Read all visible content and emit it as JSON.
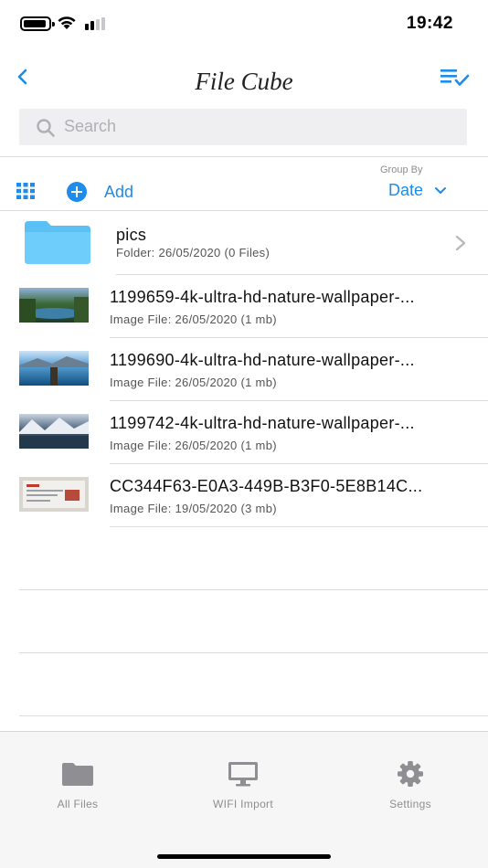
{
  "status_bar": {
    "time": "19:42"
  },
  "nav": {
    "title": "File Cube"
  },
  "search": {
    "placeholder": "Search"
  },
  "toolbar": {
    "add_label": "Add",
    "group_by_label": "Group By",
    "group_by_value": "Date"
  },
  "files": [
    {
      "name": "pics",
      "info": "Folder: 26/05/2020 (0 Files)",
      "type": "folder"
    },
    {
      "name": "1199659-4k-ultra-hd-nature-wallpaper-...",
      "info": "Image File: 26/05/2020 (1 mb)",
      "type": "image"
    },
    {
      "name": "1199690-4k-ultra-hd-nature-wallpaper-...",
      "info": "Image File: 26/05/2020 (1 mb)",
      "type": "image"
    },
    {
      "name": "1199742-4k-ultra-hd-nature-wallpaper-...",
      "info": "Image File: 26/05/2020 (1 mb)",
      "type": "image"
    },
    {
      "name": "CC344F63-E0A3-449B-B3F0-5E8B14C...",
      "info": "Image File: 19/05/2020 (3 mb)",
      "type": "image"
    }
  ],
  "tabs": [
    {
      "label": "All Files",
      "icon": "folder-icon"
    },
    {
      "label": "WIFI Import",
      "icon": "monitor-icon"
    },
    {
      "label": "Settings",
      "icon": "gear-icon"
    }
  ],
  "colors": {
    "accent": "#1d8ceb",
    "folder": "#5bc1f5",
    "tab_icon": "#8e8e93"
  }
}
